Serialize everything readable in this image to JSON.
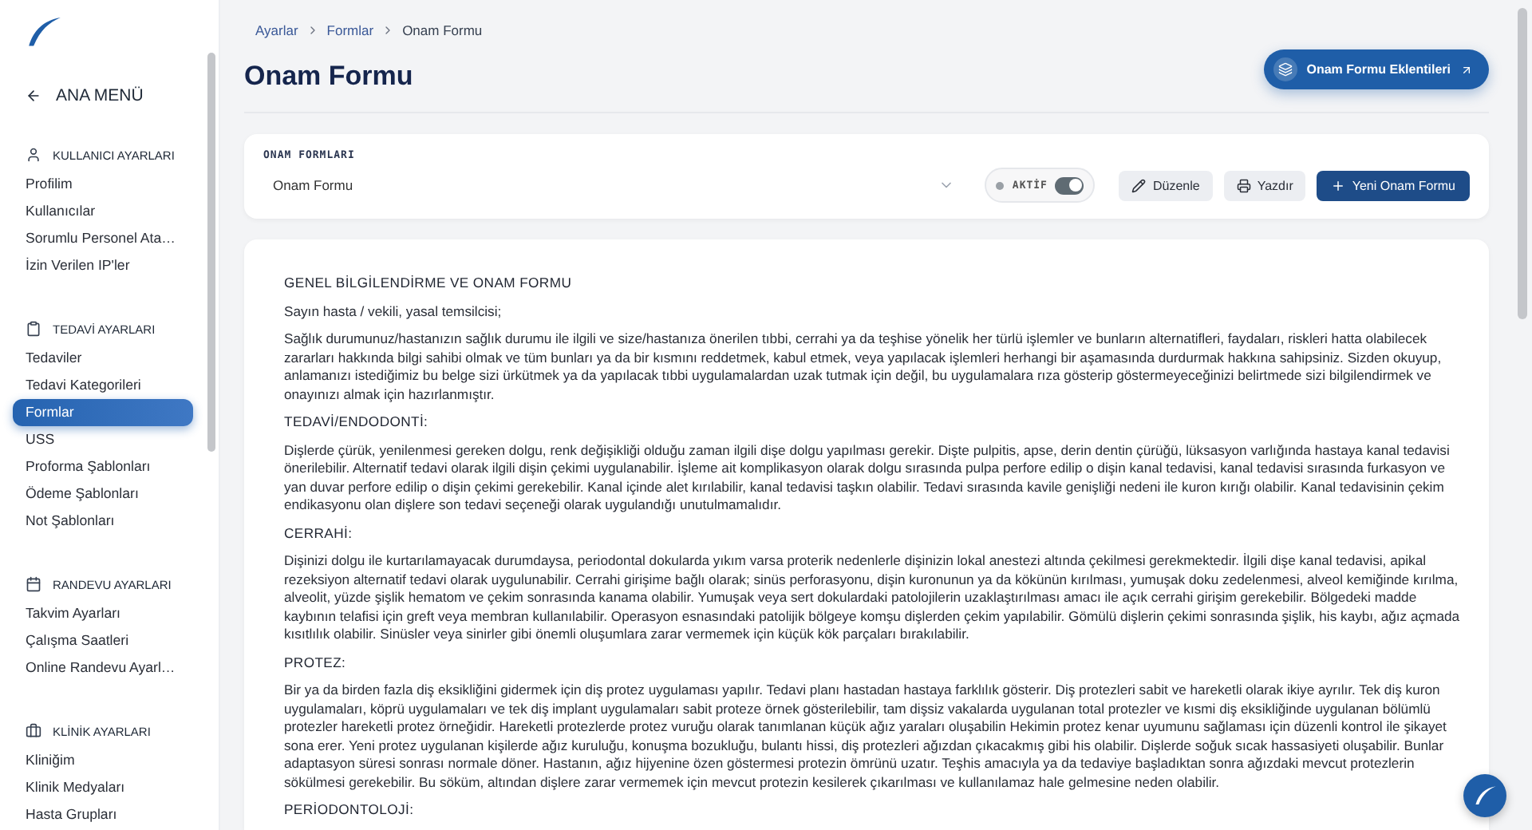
{
  "sidebar": {
    "back": {
      "label": "ANA MENÜ"
    },
    "sections": [
      {
        "title": "KULLANICI AYARLARI",
        "kind": "user",
        "items": [
          {
            "label": "Profilim",
            "selected": false
          },
          {
            "label": "Kullanıcılar",
            "selected": false
          },
          {
            "label": "Sorumlu Personel Ata…",
            "selected": false
          },
          {
            "label": "İzin Verilen IP'ler",
            "selected": false
          }
        ]
      },
      {
        "title": "TEDAVİ AYARLARI",
        "kind": "treatment",
        "items": [
          {
            "label": "Tedaviler",
            "selected": false
          },
          {
            "label": "Tedavi Kategorileri",
            "selected": false
          },
          {
            "label": "Formlar",
            "selected": true
          },
          {
            "label": "USS",
            "selected": false
          },
          {
            "label": "Proforma Şablonları",
            "selected": false
          },
          {
            "label": "Ödeme Şablonları",
            "selected": false
          },
          {
            "label": "Not Şablonları",
            "selected": false
          }
        ]
      },
      {
        "title": "RANDEVU AYARLARI",
        "kind": "calendar",
        "items": [
          {
            "label": "Takvim Ayarları",
            "selected": false
          },
          {
            "label": "Çalışma Saatleri",
            "selected": false
          },
          {
            "label": "Online Randevu Ayarl…",
            "selected": false
          }
        ]
      },
      {
        "title": "KLİNİK AYARLARI",
        "kind": "clinic",
        "items": [
          {
            "label": "Kliniğim",
            "selected": false
          },
          {
            "label": "Klinik Medyaları",
            "selected": false
          },
          {
            "label": "Hasta Grupları",
            "selected": false
          }
        ]
      }
    ]
  },
  "breadcrumb": [
    {
      "label": "Ayarlar",
      "kind": "link"
    },
    {
      "label": "Formlar",
      "kind": "link"
    },
    {
      "label": "Onam Formu",
      "kind": "current"
    }
  ],
  "page": {
    "title": "Onam Formu",
    "extensions_button": "Onam Formu Eklentileri"
  },
  "toolbar": {
    "label": "ONAM FORMLARI",
    "select": {
      "value": "Onam Formu"
    },
    "status": {
      "label": "AKTİF",
      "on": true
    },
    "buttons": [
      {
        "label": "Düzenle",
        "kind": "edit"
      },
      {
        "label": "Yazdır",
        "kind": "print"
      },
      {
        "label": "Yeni Onam Formu",
        "kind": "new"
      }
    ]
  },
  "document": {
    "blocks": [
      {
        "kind": "heading",
        "text": "GENEL BİLGİLENDİRME VE ONAM FORMU"
      },
      {
        "kind": "paragraph",
        "text": "Sayın hasta / vekili, yasal temsilcisi;"
      },
      {
        "kind": "paragraph",
        "text": "Sağlık durumunuz/hastanızın sağlık durumu ile ilgili ve size/hastanıza önerilen tıbbi, cerrahi ya da teşhise yönelik her türlü işlemler ve bunların alternatifleri, faydaları, riskleri hatta olabilecek zararları hakkında bilgi sahibi olmak ve tüm bunları ya da bir kısmını reddetmek, kabul etmek, veya yapılacak işlemleri herhangi bir aşamasında durdurmak hakkına sahipsiniz. Sizden okuyup, anlamanızı istediğimiz bu belge sizi ürkütmek ya da yapılacak tıbbi uygulamalardan uzak tutmak için değil, bu uygulamalara rıza gösterip göstermeyeceğinizi belirtmede sizi bilgilendirmek ve onayınızı almak için hazırlanmıştır."
      },
      {
        "kind": "heading",
        "text": "TEDAVİ/ENDODONTİ:"
      },
      {
        "kind": "paragraph",
        "text": "Dişlerde çürük, yenilenmesi gereken dolgu, renk değişikliği olduğu zaman ilgili dişe dolgu yapılması gerekir. Dişte pulpitis, apse, derin dentin çürüğü, lüksasyon varlığında hastaya kanal tedavisi önerilebilir. Alternatif tedavi olarak ilgili dişin çekimi uygulanabilir. İşleme ait komplikasyon olarak dolgu sırasında pulpa perfore edilip o dişin kanal tedavisi, kanal tedavisi sırasında furkasyon ve yan duvar perfore edilip o dişin çekimi gerekebilir. Kanal içinde alet kırılabilir, kanal tedavisi taşkın olabilir. Tedavi sırasında kavile genişliği nedeni ile kuron kırığı olabilir. Kanal tedavisinin çekim endikasyonu olan dişlere son tedavi seçeneği olarak uygulandığı unutulmamalıdır."
      },
      {
        "kind": "heading",
        "text": "CERRAHİ:"
      },
      {
        "kind": "paragraph",
        "text": "Dişinizi dolgu ile kurtarılamayacak durumdaysa, periodontal dokularda yıkım varsa proterik nedenlerle dişinizin lokal anestezi altında çekilmesi gerekmektedir. İlgili dişe kanal tedavisi, apikal rezeksiyon alternatif tedavi olarak uygulunabilir. Cerrahi girişime bağlı olarak; sinüs perforasyonu, dişin kuronunun ya da kökünün kırılması, yumuşak doku zedelenmesi, alveol kemiğinde kırılma, alveolit, yüzde şişlik hematom ve çekim sonrasında kanama olabilir. Yumuşak veya sert dokulardaki patolojilerin uzaklaştırılması amacı ile açık cerrahi girişim gerekebilir. Bölgedeki madde kaybının telafisi için greft veya membran kullanılabilir. Operasyon esnasındaki patolijik bölgeye komşu dişlerden çekim yapılabilir. Gömülü dişlerin çekimi sonrasında şişlik, his kaybı, ağız açmada kısıtlılık olabilir. Sinüsler veya sinirler gibi önemli oluşumlara zarar vermemek için küçük kök parçaları bırakılabilir."
      },
      {
        "kind": "heading",
        "text": "PROTEZ:"
      },
      {
        "kind": "paragraph",
        "text": "Bir ya da birden fazla diş eksikliğini gidermek için diş protez uygulaması yapılır. Tedavi planı hastadan hastaya farklılık gösterir. Diş protezleri sabit ve hareketli olarak ikiye ayrılır. Tek diş kuron uygulamaları, köprü uygulamaları ve tek diş implant uygulamaları sabit proteze örnek gösterilebilir, tam dişsiz vakalarda uygulanan total protezler ve kısmi diş eksikliğinde uygulanan bölümlü protezler hareketli protez örneğidir. Hareketli protezlerde protez vuruğu olarak tanımlanan küçük ağız yaraları oluşabilin Hekimin protez kenar uyumunu sağlaması için düzenli kontrol ile şikayet sona erer. Yeni protez uygulanan kişilerde ağız kuruluğu, konuşma bozukluğu, bulantı hissi, diş protezleri ağızdan çıkacakmış gibi his olabilir. Dişlerde soğuk sıcak hassasiyeti oluşabilir. Bunlar adaptasyon süresi sonrası normale döner. Hastanın, ağız hijyenine özen göstermesi protezin ömrünü uzatır. Teşhis amacıyla ya da tedaviye başladıktan sonra ağızdaki mevcut protezlerin sökülmesi gerekebilir. Bu söküm, altından dişlere zarar vermemek için mevcut protezin kesilerek çıkarılması ve kullanılamaz hale gelmesine neden olabilir."
      },
      {
        "kind": "heading",
        "text": "PERİODONTOLOJİ:"
      }
    ]
  }
}
